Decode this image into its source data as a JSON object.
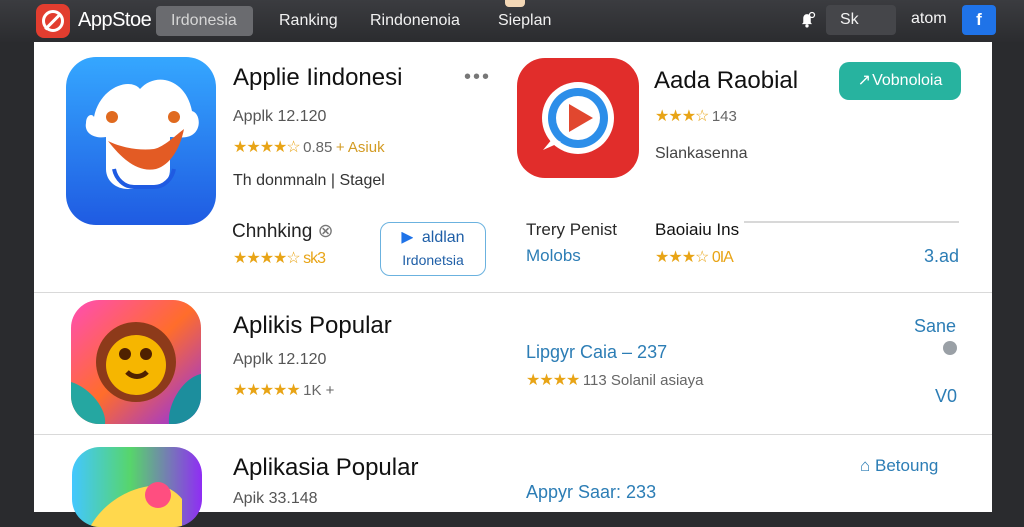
{
  "topbar": {
    "brand": "AppStoe",
    "tabs": [
      "Irdonesia",
      "Ranking",
      "Rindonenoia",
      "Sieplan"
    ],
    "search_text": "Sk",
    "account_text": "atom",
    "facebook_label": "f",
    "colors": {
      "bar": "#2b2c2f",
      "fb": "#1f73e8",
      "logo": "#e23d2f"
    }
  },
  "apps": {
    "first": {
      "title": "Applie Iindonesi",
      "meta": "Applk 12.120",
      "stars": "★★★★☆",
      "rating_text": "0.85",
      "extra": "+ Asiuk",
      "developer": "Th donmnaln | Stagel",
      "more": "•••"
    },
    "second": {
      "title": "Aada Raobial",
      "button": "Vobnoloia",
      "stars": "★★★☆",
      "rating": "143",
      "subtitle": "Slankasenna"
    },
    "row2": {
      "left_label": "Chnhking",
      "left_meta": "★★★★☆ sk3",
      "button_primary": "aldlan",
      "button_secondary": "Irdonetsia",
      "center_line1": "Trery Penist",
      "center_line2": "Molobs",
      "right_label": "Baoiaiu Ins",
      "right_stars": "★★★☆ 0IA",
      "right_value": "3.ad"
    },
    "popular1": {
      "title": "Aplikis Popular",
      "meta": "Applk 12.120",
      "stars": "★★★★★",
      "extra": "1K +",
      "center_title": "Lipgyr Caia – 237",
      "center_stars": "★★★★",
      "center_meta": "113 Solanil asiaya",
      "right_top": "Sane",
      "right_bottom": "V0"
    },
    "popular2": {
      "title": "Aplikasia Popular",
      "meta": "Apik 33.148",
      "center_title": "Appyr Saar: 233",
      "right_top": "Betoung"
    }
  }
}
